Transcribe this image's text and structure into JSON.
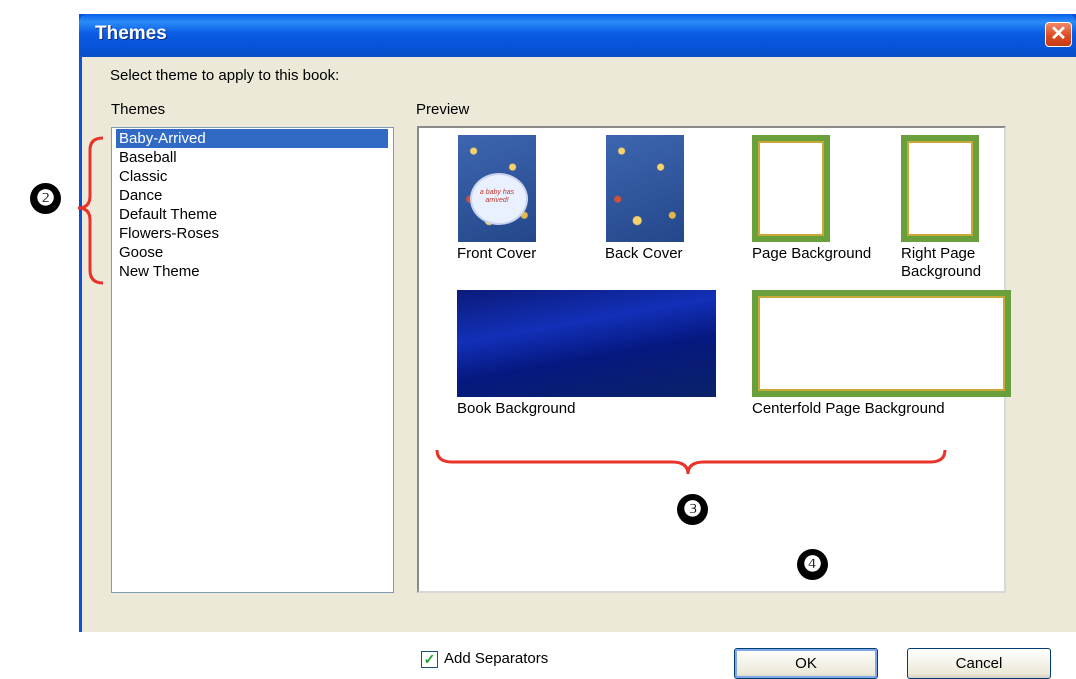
{
  "window": {
    "title": "Themes",
    "close_glyph": "✕"
  },
  "instruction": "Select theme to apply to this book:",
  "themes": {
    "label": "Themes",
    "items": [
      "Baby-Arrived",
      "Baseball",
      "Classic",
      "Dance",
      "Default Theme",
      "Flowers-Roses",
      "Goose",
      "New Theme"
    ],
    "selected": "Baby-Arrived"
  },
  "preview": {
    "label": "Preview",
    "captions": {
      "front_cover": "Front Cover",
      "back_cover": "Back Cover",
      "page_background": "Page Background",
      "right_page_background": "Right Page Background",
      "book_background": "Book Background",
      "centerfold_page_background": "Centerfold Page Background"
    },
    "front_cover_text": "a baby has arrived!"
  },
  "options": {
    "add_separators_label": "Add Separators",
    "add_separators_checked": true
  },
  "buttons": {
    "ok": "OK",
    "cancel": "Cancel"
  },
  "annotations": {
    "two": "❷",
    "three": "❸",
    "four": "❹"
  },
  "colors": {
    "selection": "#316ac5",
    "annotation_red": "#e8322a",
    "title_bar": "#0a5ce4"
  }
}
